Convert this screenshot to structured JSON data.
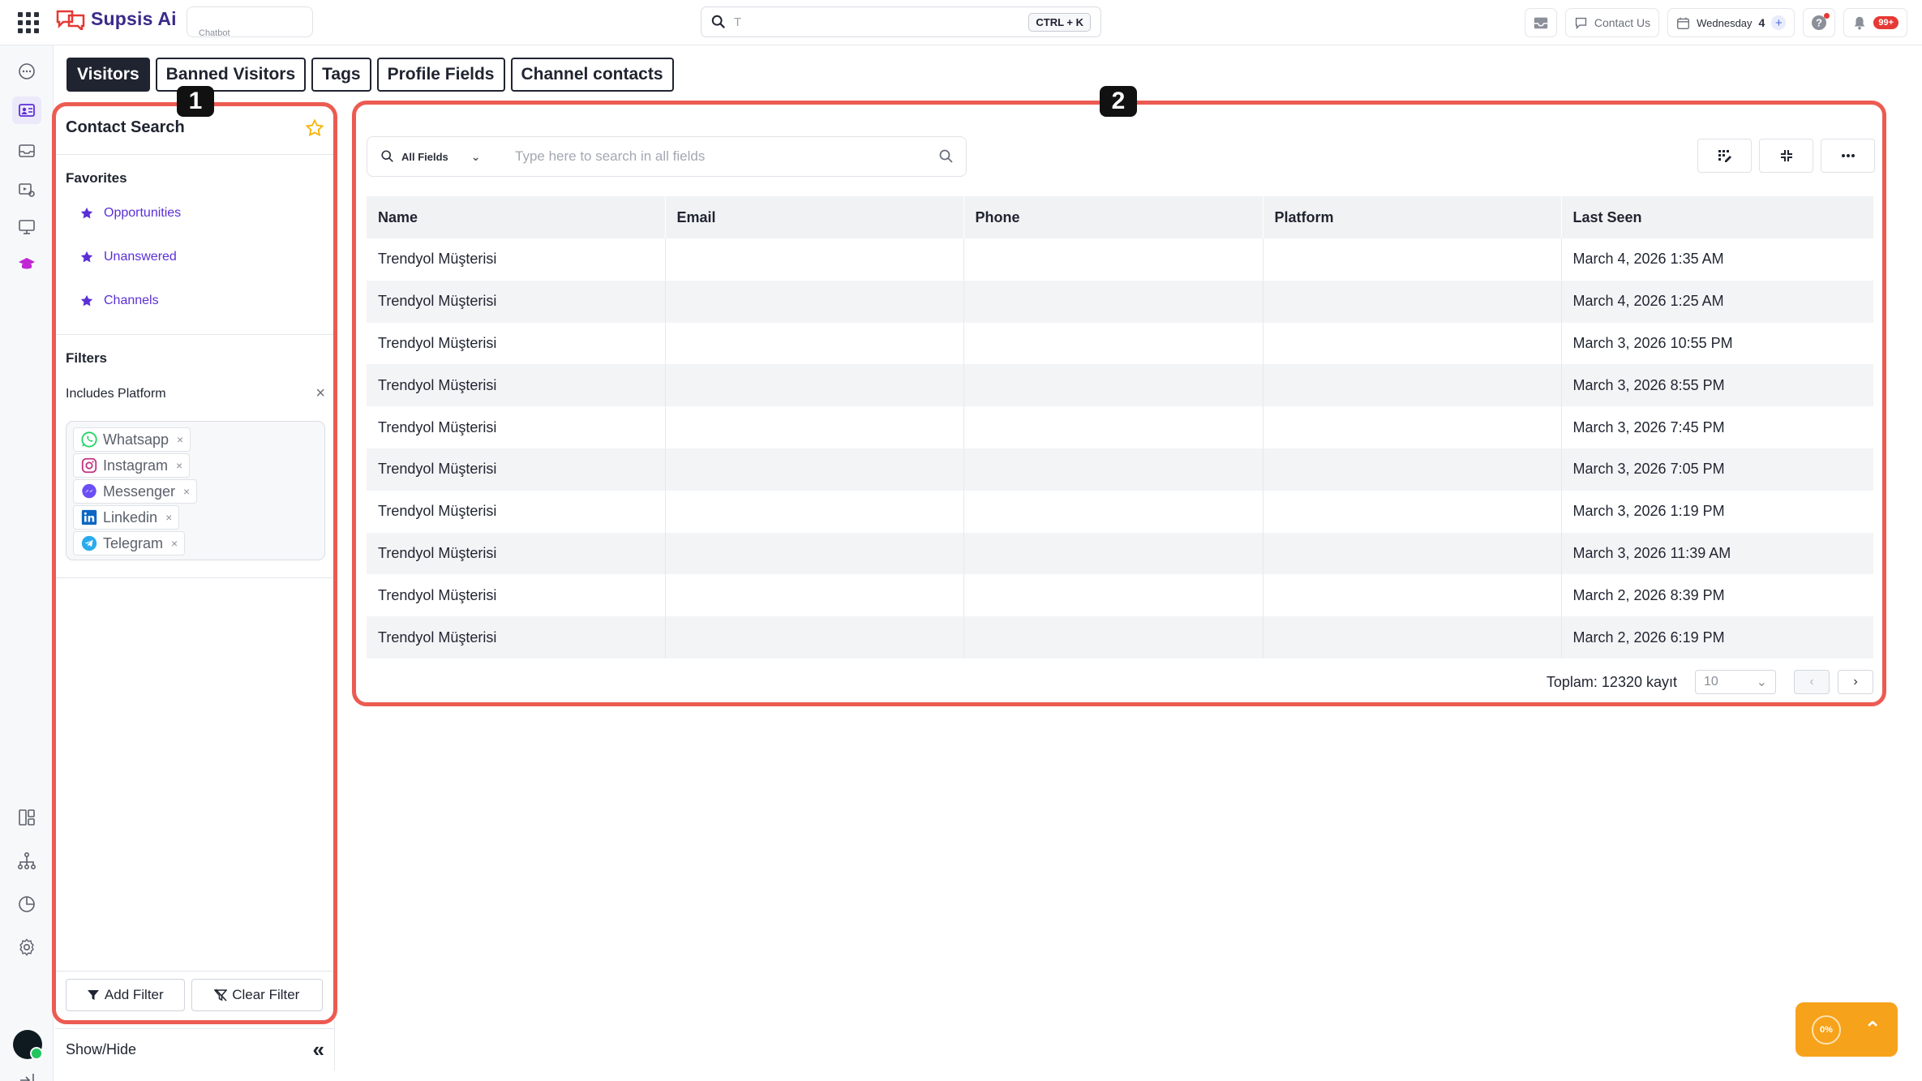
{
  "app": {
    "name": "Supsis Ai",
    "chatbot_label": "Chatbot"
  },
  "search": {
    "value": "T",
    "shortcut": "CTRL + K"
  },
  "topbar": {
    "contact_us": "Contact Us",
    "day": "Wednesday",
    "day_num": "4",
    "notif_badge": "99+"
  },
  "tabs": [
    {
      "label": "Visitors"
    },
    {
      "label": "Banned Visitors"
    },
    {
      "label": "Tags"
    },
    {
      "label": "Profile Fields"
    },
    {
      "label": "Channel contacts"
    }
  ],
  "markers": {
    "one": "1",
    "two": "2"
  },
  "contact_search": {
    "title": "Contact Search",
    "favorites_title": "Favorites",
    "favorites": [
      "Opportunities",
      "Unanswered",
      "Channels"
    ],
    "filters_title": "Filters",
    "includes_platform": "Includes Platform",
    "platforms": [
      {
        "label": "Whatsapp",
        "icon": "whatsapp-icon",
        "color": "#25D366"
      },
      {
        "label": "Instagram",
        "icon": "instagram-icon",
        "color": "#C13584"
      },
      {
        "label": "Messenger",
        "icon": "messenger-icon",
        "color": "#6B4EF6"
      },
      {
        "label": "Linkedin",
        "icon": "linkedin-icon",
        "color": "#0A66C2"
      },
      {
        "label": "Telegram",
        "icon": "telegram-icon",
        "color": "#2AABEE"
      }
    ],
    "add_filter": "Add Filter",
    "clear_filter": "Clear Filter",
    "show_hide": "Show/Hide"
  },
  "table": {
    "search_scope": "All Fields",
    "search_placeholder": "Type here to search in all fields",
    "columns": [
      "Name",
      "Email",
      "Phone",
      "Platform",
      "Last Seen"
    ],
    "rows": [
      [
        "Trendyol Müşterisi",
        "",
        "",
        "",
        "March 4, 2026 1:35 AM"
      ],
      [
        "Trendyol Müşterisi",
        "",
        "",
        "",
        "March 4, 2026 1:25 AM"
      ],
      [
        "Trendyol Müşterisi",
        "",
        "",
        "",
        "March 3, 2026 10:55 PM"
      ],
      [
        "Trendyol Müşterisi",
        "",
        "",
        "",
        "March 3, 2026 8:55 PM"
      ],
      [
        "Trendyol Müşterisi",
        "",
        "",
        "",
        "March 3, 2026 7:45 PM"
      ],
      [
        "Trendyol Müşterisi",
        "",
        "",
        "",
        "March 3, 2026 7:05 PM"
      ],
      [
        "Trendyol Müşterisi",
        "",
        "",
        "",
        "March 3, 2026 1:19 PM"
      ],
      [
        "Trendyol Müşterisi",
        "",
        "",
        "",
        "March 3, 2026 11:39 AM"
      ],
      [
        "Trendyol Müşterisi",
        "",
        "",
        "",
        "March 2, 2026 8:39 PM"
      ],
      [
        "Trendyol Müşterisi",
        "",
        "",
        "",
        "March 2, 2026 6:19 PM"
      ]
    ],
    "total": "Toplam: 12320 kayıt",
    "page_size": "10"
  },
  "fab": {
    "progress": "0%"
  },
  "colors": {
    "accent": "#5B2FD6",
    "annotation": "#EC5B52",
    "fab": "#F7A21B"
  }
}
